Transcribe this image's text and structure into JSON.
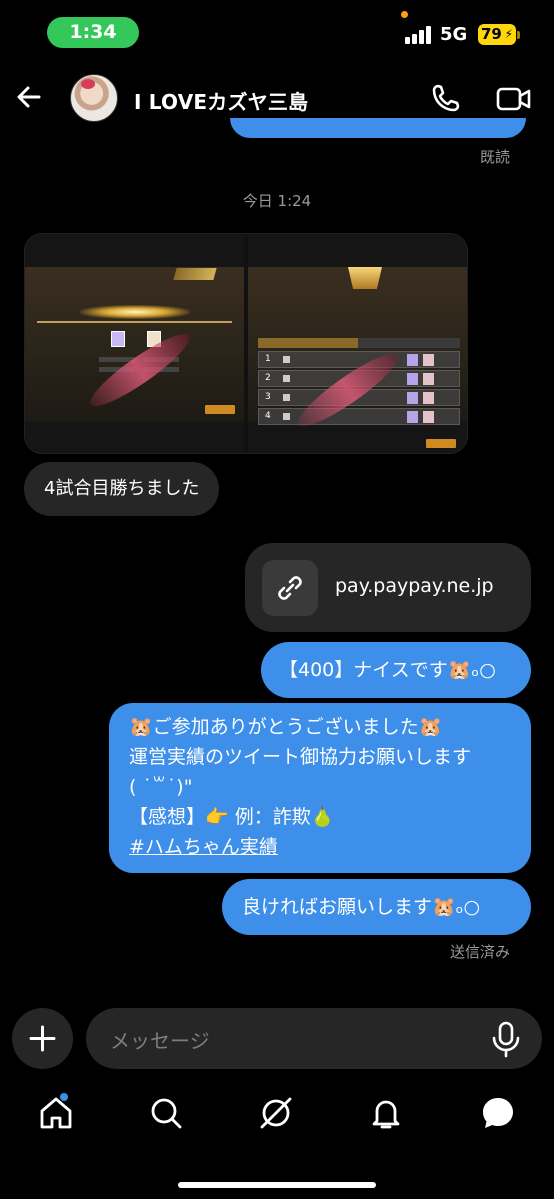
{
  "status": {
    "time": "1:34",
    "network": "5G",
    "battery": "79"
  },
  "header": {
    "title": "I LOVEカズヤ三島"
  },
  "thread": {
    "read_receipt": "既読",
    "day_separator": "今日 1:24",
    "incoming_text": "4試合目勝ちました",
    "link_card": {
      "url": "pay.paypay.ne.jp"
    },
    "outgoing": {
      "msg1": "【400】ナイスです🐹ₒ○",
      "msg2_lines": [
        "🐹ご参加ありがとうございました🐹",
        "運営実績のツイート御協力お願いします",
        "( ˙꒳˙)\"",
        "【感想】👉 例：詐欺🍐"
      ],
      "msg2_hashtag": "#ハムちゃん実績",
      "msg3": "良ければお願いします🐹ₒ○"
    },
    "sent_receipt": "送信済み"
  },
  "composer": {
    "placeholder": "メッセージ"
  },
  "icons": {
    "back": "arrow-left-icon",
    "call": "phone-icon",
    "video": "video-camera-icon",
    "link": "link-icon",
    "plus": "plus-icon",
    "mic": "microphone-icon",
    "home": "home-icon",
    "search": "search-icon",
    "explore": "compass-icon",
    "notifications": "bell-icon",
    "messages": "chat-bubble-icon"
  },
  "colors": {
    "outgoing_bubble": "#3d8fe9",
    "incoming_bubble": "#262626",
    "time_pill": "#34c759",
    "battery": "#ffd60a"
  }
}
